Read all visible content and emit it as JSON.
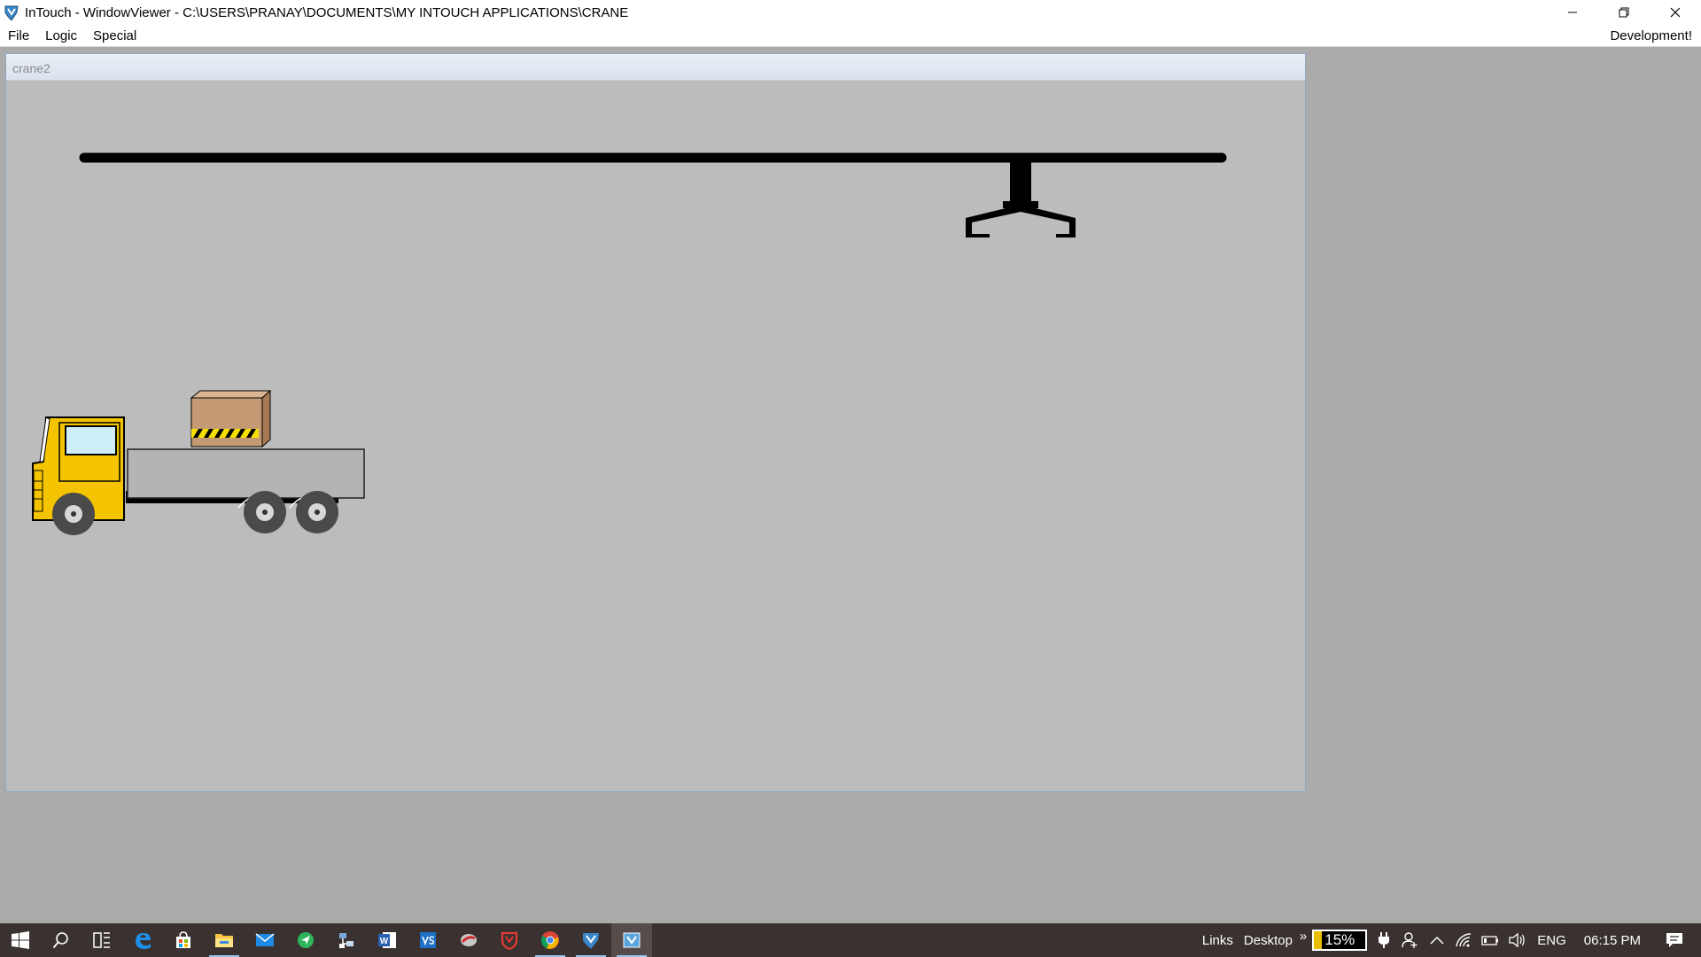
{
  "window": {
    "title": "InTouch - WindowViewer - C:\\USERS\\PRANAY\\DOCUMENTS\\MY INTOUCH APPLICATIONS\\CRANE"
  },
  "menu": {
    "items": [
      "File",
      "Logic",
      "Special"
    ],
    "right_label": "Development!"
  },
  "child_window": {
    "title": "crane2"
  },
  "colors": {
    "truck_cab": "#f5c400",
    "truck_bed": "#b4b4b4",
    "cargo_box": "#c49a74",
    "crane_beam": "#000000",
    "canvas_bg": "#bcbcbc",
    "battery_level": "#e8c000"
  },
  "taskbar": {
    "icons": [
      "windows-start-icon",
      "search-icon",
      "task-view-icon",
      "edge-icon",
      "store-icon",
      "file-explorer-icon",
      "mail-icon",
      "green-app-icon",
      "network-app-icon",
      "word-icon",
      "visual-studio-icon",
      "red-app-icon",
      "shield-app-icon",
      "chrome-icon",
      "intouch-icon",
      "windowviewer-icon"
    ],
    "links_label": "Links",
    "desktop_label": "Desktop",
    "overflow": "»",
    "battery_percent": "15%",
    "battery_fraction": 0.15,
    "language": "ENG",
    "time": "06:15 PM"
  }
}
